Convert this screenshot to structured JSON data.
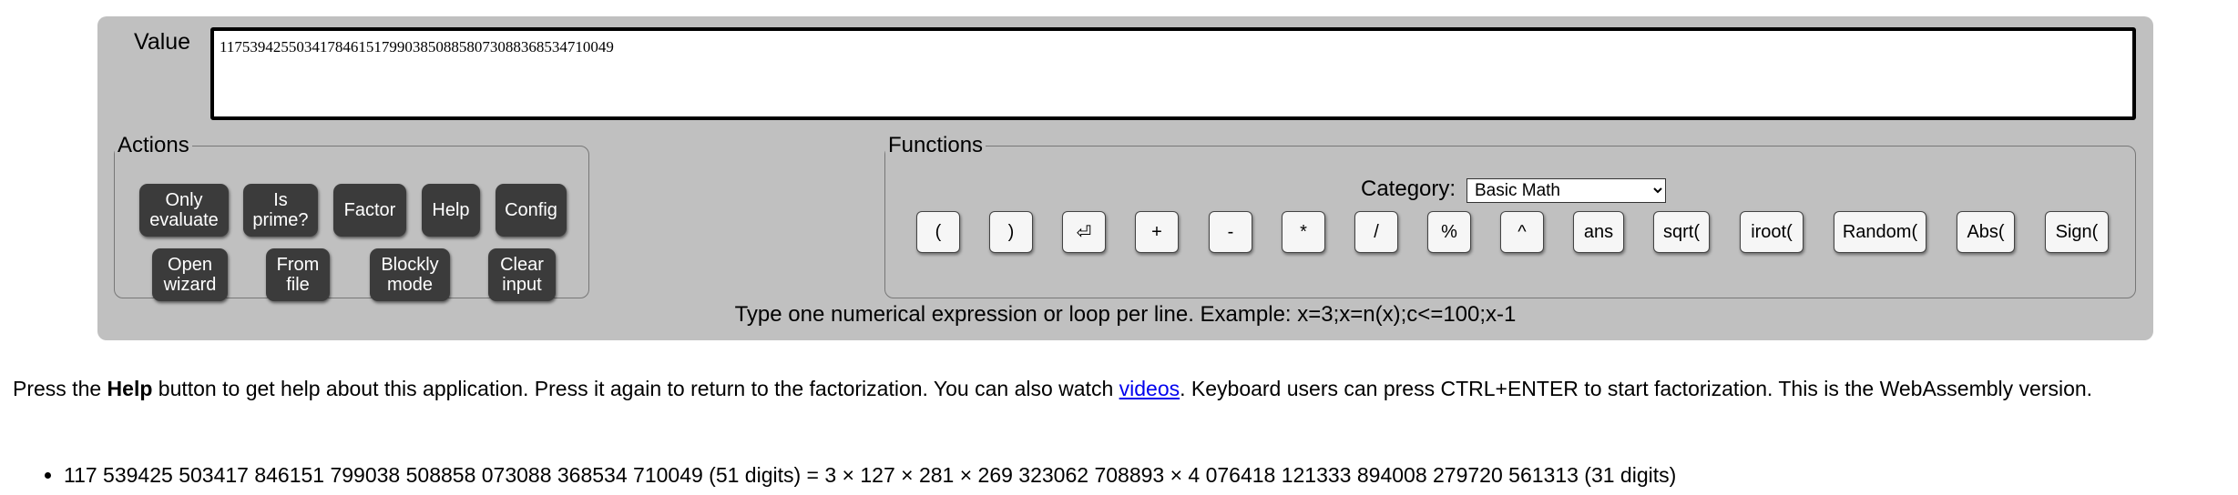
{
  "value": {
    "label": "Value",
    "input_value": "117539425503417846151799038508858073088368534710049"
  },
  "actions": {
    "legend": "Actions",
    "buttons": {
      "only_evaluate": "Only\nevaluate",
      "is_prime": "Is\nprime?",
      "factor": "Factor",
      "help": "Help",
      "config": "Config",
      "open_wizard": "Open\nwizard",
      "from_file": "From\nfile",
      "blockly_mode": "Blockly\nmode",
      "clear_input": "Clear\ninput"
    }
  },
  "functions": {
    "legend": "Functions",
    "category_label": "Category:",
    "category_selected": "Basic Math",
    "buttons": [
      "(",
      ")",
      "⏎",
      "+",
      "-",
      "*",
      "/",
      "%",
      "^",
      "ans",
      "sqrt(",
      "iroot(",
      "Random(",
      "Abs(",
      "Sign("
    ]
  },
  "hint": "Type one numerical expression or loop per line. Example: x=3;x=n(x);c<=100;x-1",
  "help_text": {
    "prefix": "Press the ",
    "bold": "Help",
    "middle": " button to get help about this application. Press it again to return to the factorization. You can also watch ",
    "link": "videos",
    "suffix": ". Keyboard users can press CTRL+ENTER to start factorization. This is the WebAssembly version."
  },
  "results": [
    "117 539425 503417 846151 799038 508858 073088 368534 710049 (51 digits) = 3 × 127 × 281 × 269 323062 708893 × 4 076418 121333 894008 279720 561313 (31 digits)"
  ]
}
